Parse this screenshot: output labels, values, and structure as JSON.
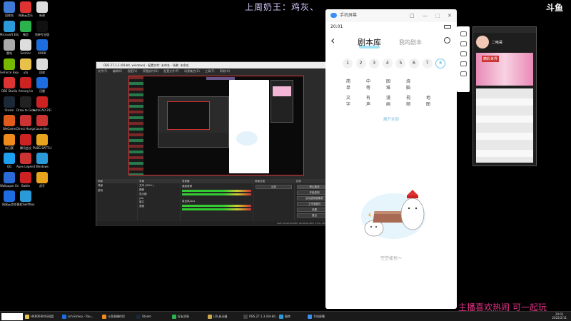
{
  "banner": {
    "top": "上周奶王：鸡灰、",
    "bottom": "主播喜欢热闹 可一起玩",
    "corner_logo": "斗鱼"
  },
  "desktop_icons": [
    {
      "label": "回收站",
      "color": "#3f7bd6"
    },
    {
      "label": "网易云音乐",
      "color": "#d33"
    },
    {
      "label": "新建",
      "color": "#ddd"
    },
    {
      "label": "Microsoft Edge",
      "color": "#2a9bd8"
    },
    {
      "label": "微信",
      "color": "#2bb24c"
    },
    {
      "label": "剪映专业版",
      "color": "#111"
    },
    {
      "label": "雷电",
      "color": "#aaa"
    },
    {
      "label": "Sentinc",
      "color": "#ddd"
    },
    {
      "label": "KOOK",
      "color": "#1e6de0"
    },
    {
      "label": "GeForce Experience",
      "color": "#76b900"
    },
    {
      "label": "yhj",
      "color": "#e8c14b"
    },
    {
      "label": "回收",
      "color": "#ddd"
    },
    {
      "label": "OBS Studio",
      "color": "#d33"
    },
    {
      "label": "Among Us",
      "color": "#c22"
    },
    {
      "label": "迅雷",
      "color": "#1e6de0"
    },
    {
      "label": "Steam",
      "color": "#1b2838"
    },
    {
      "label": "Draw to Glow",
      "color": "#222"
    },
    {
      "label": "AutoCAD 2020",
      "color": "#c22"
    },
    {
      "label": "WeGame",
      "color": "#e05a1c"
    },
    {
      "label": "Direct Hanger",
      "color": "#c33"
    },
    {
      "label": "Launcher",
      "color": "#c33"
    },
    {
      "label": "向日葵",
      "color": "#f08a1c"
    },
    {
      "label": "腾讯会议",
      "color": "#c22"
    },
    {
      "label": "PUBG BATTLEGR",
      "color": "#e8a41c"
    },
    {
      "label": "QQ",
      "color": "#1ea0f0"
    },
    {
      "label": "Apex Legends",
      "color": "#c33"
    },
    {
      "label": "Windows",
      "color": "#2a9bd8"
    },
    {
      "label": "Wallpaper Engine",
      "color": "#2a6bd8"
    },
    {
      "label": "Battle",
      "color": "#c22"
    },
    {
      "label": "虎牙",
      "color": "#e8a41c"
    },
    {
      "label": "网易云游戏",
      "color": "#1e6de0"
    },
    {
      "label": "微软SwiftKey",
      "color": "#2a9bd8"
    }
  ],
  "obs": {
    "title": "OBS 27.1.3 (64-bit, windows) - 配置文件: 未命名 - 场景: 未命名",
    "menu": [
      "文件(F)",
      "编辑(E)",
      "视图(V)",
      "停靠部件(D)",
      "配置文件(P)",
      "场景集合(S)",
      "工具(T)",
      "帮助(H)"
    ],
    "docks": {
      "scenes": {
        "header": "场景",
        "items": [
          "场景",
          "游戏"
        ]
      },
      "sources": {
        "header": "来源",
        "items": [
          "文本 (GDI+)",
          "图像",
          "显示器",
          "yfw",
          "窗口",
          "音频"
        ]
      },
      "mixer": {
        "header": "混音器",
        "tracks": [
          "桌面音频",
          "麦克风/Aux"
        ]
      },
      "transitions": {
        "header": "场景过渡",
        "value": "淡化"
      },
      "controls": {
        "header": "控件",
        "buttons": [
          "停止推流",
          "开始录制",
          "启动虚拟摄像机",
          "工作室模式",
          "设置",
          "退出"
        ]
      }
    },
    "status": "LIVE: 00:00:00   REC: 00:00:00   CPU: 3.2%, 30.00 fps"
  },
  "phone": {
    "window_title": "手机屏幕",
    "window_controls": [
      "□",
      "—",
      "⬚",
      "✕"
    ],
    "time": "20:01",
    "back_icon": "‹",
    "tabs": {
      "active": "剧本库",
      "inactive": "我的剧本"
    },
    "numbers": [
      "1",
      "2",
      "3",
      "4",
      "5",
      "6",
      "7",
      "8"
    ],
    "selected_number": "8",
    "difficulty": [
      "简单",
      "中等",
      "困难",
      "烧脑"
    ],
    "types": [
      "文字",
      "有声",
      "漫画",
      "视频",
      "地图"
    ],
    "view_all": "展开全部",
    "empty_text": "空空如也～"
  },
  "right_phone": {
    "name": "二哈哥",
    "banner": "精彩世界"
  },
  "taskbar": {
    "items": [
      {
        "label": "HKB06804G网盘",
        "color": "#e8c14b"
      },
      {
        "label": "sch-Emery - Rou...",
        "color": "#1e6de0"
      },
      {
        "label": "斗鱼直播伴侣",
        "color": "#f08a1c"
      },
      {
        "label": "Steam",
        "color": "#1b2838"
      },
      {
        "label": "好友消息",
        "color": "#2bb24c"
      },
      {
        "label": "LOL启动器",
        "color": "#c8a84b"
      },
      {
        "label": "OBS 27.1.3 (64-bit...",
        "color": "#444"
      },
      {
        "label": "图库",
        "color": "#2a9bd8"
      },
      {
        "label": "手机屏幕",
        "color": "#3a8ef5"
      }
    ],
    "clock_time": "20:01",
    "clock_date": "2022/2/11"
  }
}
